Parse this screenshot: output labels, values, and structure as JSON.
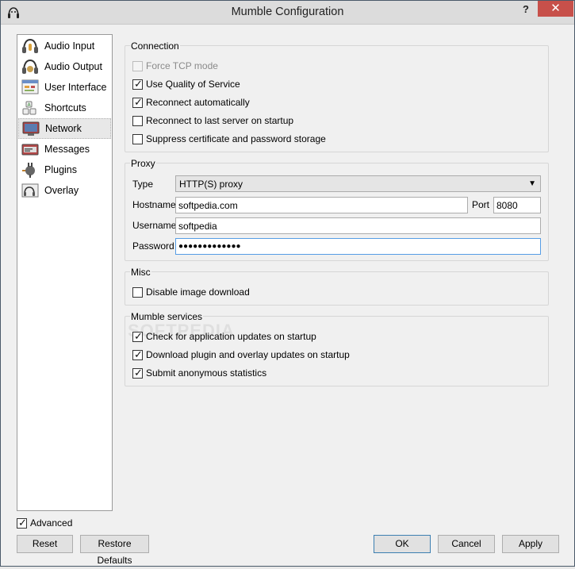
{
  "window": {
    "title": "Mumble Configuration",
    "help": "?",
    "close": "✕"
  },
  "sidebar": {
    "items": [
      {
        "label": "Audio Input",
        "icon": "audio-input-icon"
      },
      {
        "label": "Audio Output",
        "icon": "audio-output-icon"
      },
      {
        "label": "User Interface",
        "icon": "user-interface-icon"
      },
      {
        "label": "Shortcuts",
        "icon": "shortcuts-icon"
      },
      {
        "label": "Network",
        "icon": "network-icon",
        "selected": true
      },
      {
        "label": "Messages",
        "icon": "messages-icon"
      },
      {
        "label": "Plugins",
        "icon": "plugins-icon"
      },
      {
        "label": "Overlay",
        "icon": "overlay-icon"
      }
    ]
  },
  "connection": {
    "title": "Connection",
    "options": [
      {
        "label": "Force TCP mode",
        "checked": false,
        "disabled": true
      },
      {
        "label": "Use Quality of Service",
        "checked": true
      },
      {
        "label": "Reconnect automatically",
        "checked": true
      },
      {
        "label": "Reconnect to last server on startup",
        "checked": false
      },
      {
        "label": "Suppress certificate and password storage",
        "checked": false
      }
    ]
  },
  "proxy": {
    "title": "Proxy",
    "type_label": "Type",
    "type_value": "HTTP(S) proxy",
    "hostname_label": "Hostname",
    "hostname_value": "softpedia.com",
    "port_label": "Port",
    "port_value": "8080",
    "username_label": "Username",
    "username_value": "softpedia",
    "password_label": "Password",
    "password_value": "●●●●●●●●●●●●●"
  },
  "misc": {
    "title": "Misc",
    "options": [
      {
        "label": "Disable image download",
        "checked": false
      }
    ]
  },
  "services": {
    "title": "Mumble services",
    "options": [
      {
        "label": "Check for application updates on startup",
        "checked": true
      },
      {
        "label": "Download plugin and overlay updates on startup",
        "checked": true
      },
      {
        "label": "Submit anonymous statistics",
        "checked": true
      }
    ]
  },
  "footer": {
    "advanced_label": "Advanced",
    "advanced_checked": true,
    "reset": "Reset",
    "restore": "Restore Defaults",
    "ok": "OK",
    "cancel": "Cancel",
    "apply": "Apply"
  },
  "watermark": "SOFTPEDIA",
  "colors": {
    "close": "#c7504a",
    "focus": "#569de5"
  }
}
